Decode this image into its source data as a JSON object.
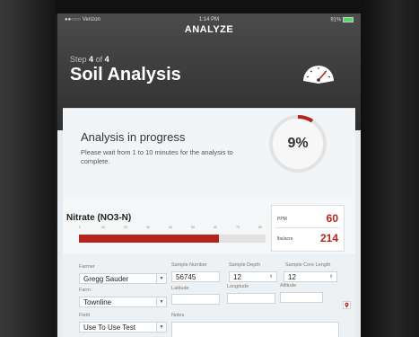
{
  "status_bar": {
    "carrier": "●●○○○ Verizon",
    "time": "1:14 PM",
    "battery": "91%"
  },
  "nav": {
    "title": "ANALYZE"
  },
  "header": {
    "step_prefix": "Step",
    "step_current": "4",
    "step_of": "of",
    "step_total": "4",
    "title": "Soil Analysis"
  },
  "analysis": {
    "title": "Analysis in progress",
    "description": "Please wait from 1 to 10 minutes for the analysis to complete.",
    "percent_label": "9%",
    "progress": 0.09
  },
  "nitrate": {
    "label": "Nitrate (NO3-N)",
    "scale_ticks": [
      "0",
      "10",
      "20",
      "30",
      "40",
      "50",
      "60",
      "70",
      "80"
    ],
    "bar_fraction": 0.75,
    "ppm_unit": "PPM",
    "ppm_value": "60",
    "lbs_unit": "lbs/acre",
    "lbs_value": "214"
  },
  "form": {
    "farmer_label": "Farmer",
    "farmer_value": "Gregg Sauder",
    "farm_label": "Farm",
    "farm_value": "Townline",
    "field_label": "Field",
    "field_value": "Use To Use Test",
    "sample_number_label": "Sample Number",
    "sample_number_value": "56745",
    "sample_depth_label": "Sample Depth",
    "sample_depth_value": "12",
    "core_length_label": "Sample Core Length",
    "core_length_value": "12",
    "latitude_label": "Latitude",
    "longitude_label": "Longitude",
    "altitude_label": "Altitude",
    "notes_label": "Notes"
  },
  "colors": {
    "accent": "#b3241d",
    "header_bg": "#3c3c3c"
  }
}
